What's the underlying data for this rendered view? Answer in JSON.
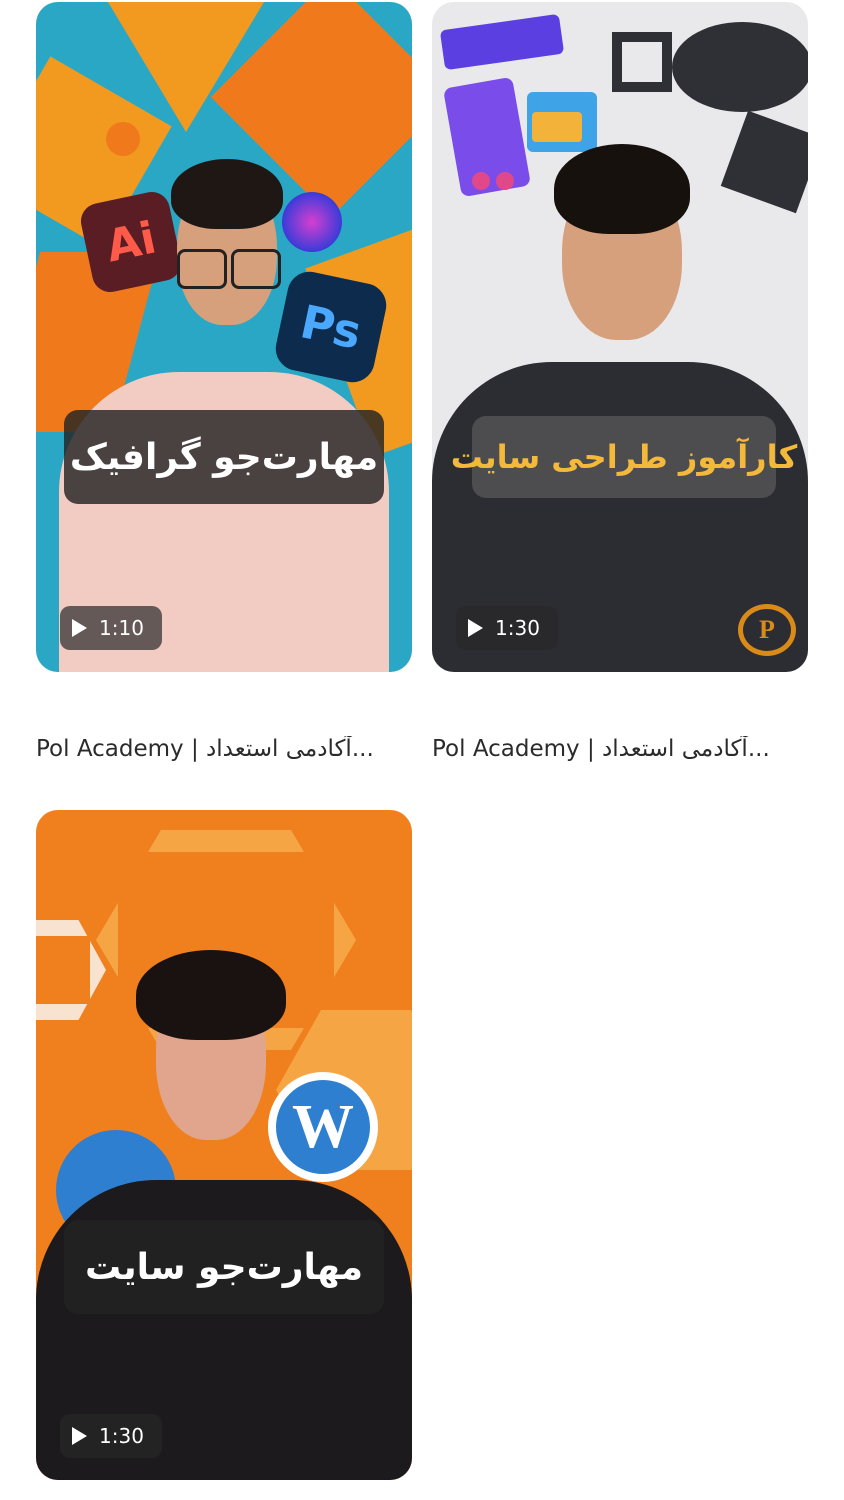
{
  "videos": [
    {
      "title": "مهارت‌جو گرافیک",
      "duration": "1:10",
      "caption": "Pol Academy | آکادمی استعداد...",
      "has_logo": false,
      "background_colors": [
        "#2aa7c4",
        "#f29a1f",
        "#f07a1b"
      ]
    },
    {
      "title": "کارآموز طراحی سایت",
      "duration": "1:30",
      "caption": "Pol Academy | آکادمی استعداد...",
      "has_logo": true,
      "background_colors": [
        "#e9e9ec",
        "#2f2f36",
        "#6b46e0"
      ]
    },
    {
      "title": "مهارت‌جو سایت",
      "duration": "1:30",
      "caption": "",
      "has_logo": false,
      "background_colors": [
        "#f07f1e",
        "#f6a544",
        "#2f7fd0"
      ]
    }
  ],
  "icons": {
    "play": "play-icon",
    "logo": "pol-academy-logo-icon"
  }
}
